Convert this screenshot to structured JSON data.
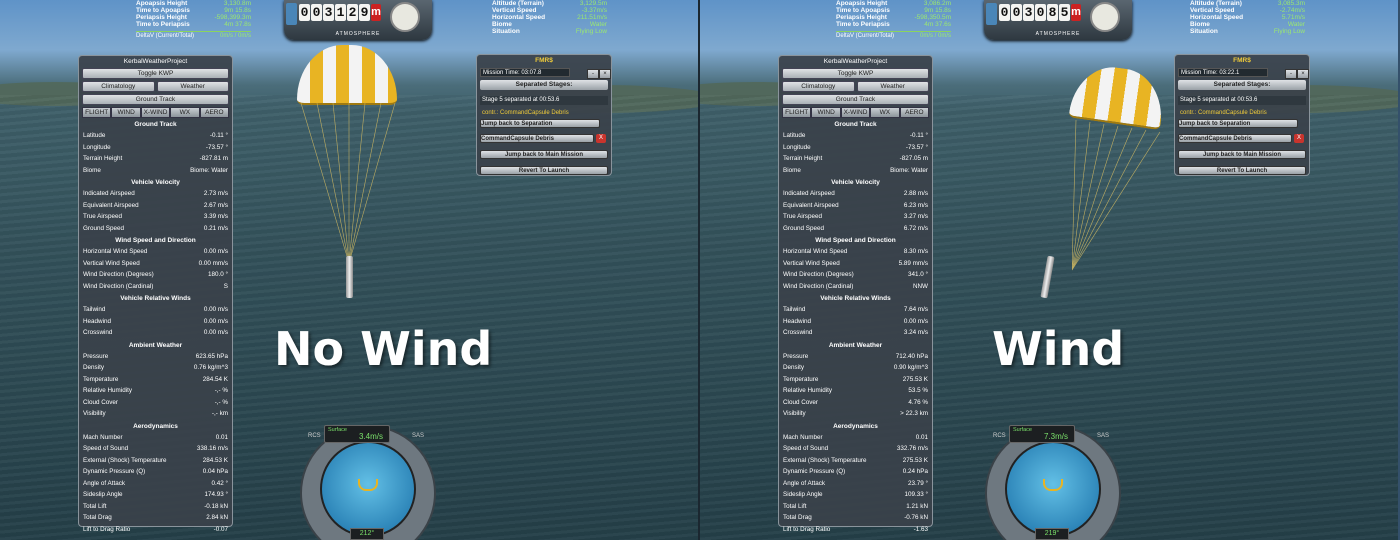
{
  "panels": [
    {
      "caption": "No Wind",
      "orbit": {
        "rows": [
          {
            "label": "Apoapsis Height",
            "value": "3,130.8m"
          },
          {
            "label": "Time to Apoapsis",
            "value": "9m 15.8s"
          },
          {
            "label": "Periapsis Height",
            "value": "-598,399.3m"
          },
          {
            "label": "Time to Periapsis",
            "value": "4m 37.8s"
          }
        ],
        "deltav_label": "DeltaV (Current/Total)",
        "deltav_value": "0m/s / 0m/s"
      },
      "surface": {
        "rows": [
          {
            "label": "Altitude (Terrain)",
            "value": "3,129.5m"
          },
          {
            "label": "Vertical Speed",
            "value": "-3.37m/s"
          },
          {
            "label": "Horizontal Speed",
            "value": "211.51m/s"
          },
          {
            "label": "Biome",
            "value": "Water"
          },
          {
            "label": "Situation",
            "value": "Flying Low"
          }
        ]
      },
      "altimeter": {
        "digits": [
          "0",
          "0",
          "3",
          "1",
          "2",
          "9"
        ],
        "unit": "m",
        "mode": "ATMOSPHERE"
      },
      "kwp": {
        "title": "KerbalWeatherProject",
        "toggle": "Toggle KWP",
        "climatology": "Climatology",
        "weather": "Weather",
        "ground_track": "Ground Track",
        "tabs": [
          "FLIGHT",
          "WIND",
          "X-WIND",
          "WX",
          "AERO"
        ],
        "sections": [
          {
            "title": "Ground Track",
            "rows": [
              {
                "label": "Latitude",
                "value": "-0.11 °"
              },
              {
                "label": "Longitude",
                "value": "-73.57 °"
              },
              {
                "label": "Terrain Height",
                "value": "-827.81 m"
              },
              {
                "label": "Biome",
                "value": "Biome: Water"
              }
            ]
          },
          {
            "title": "Vehicle Velocity",
            "rows": [
              {
                "label": "Indicated Airspeed",
                "value": "2.73 m/s"
              },
              {
                "label": "Equivalent Airspeed",
                "value": "2.67 m/s"
              },
              {
                "label": "True Airspeed",
                "value": "3.39 m/s"
              },
              {
                "label": "Ground Speed",
                "value": "0.21 m/s"
              }
            ]
          },
          {
            "title": "Wind Speed and Direction",
            "rows": [
              {
                "label": "Horizontal Wind Speed",
                "value": "0.00 m/s"
              },
              {
                "label": "Vertical Wind Speed",
                "value": "0.00 mm/s"
              },
              {
                "label": "Wind Direction (Degrees)",
                "value": "180.0 °"
              },
              {
                "label": "Wind Direction (Cardinal)",
                "value": "S"
              }
            ]
          },
          {
            "title": "Vehicle Relative Winds",
            "rows": [
              {
                "label": "Tailwind",
                "value": "0.00 m/s"
              },
              {
                "label": "Headwind",
                "value": "0.00 m/s"
              },
              {
                "label": "Crosswind",
                "value": "0.00 m/s"
              }
            ]
          },
          {
            "title": "Ambient Weather",
            "rows": [
              {
                "label": "Pressure",
                "value": "623.65 hPa"
              },
              {
                "label": "Density",
                "value": "0.76 kg/m^3"
              },
              {
                "label": "Temperature",
                "value": "284.54 K"
              },
              {
                "label": "Relative Humidity",
                "value": "-,- %"
              },
              {
                "label": "Cloud Cover",
                "value": "-,- %"
              },
              {
                "label": "Visibility",
                "value": "-,- km"
              }
            ]
          },
          {
            "title": "Aerodynamics",
            "rows": [
              {
                "label": "Mach Number",
                "value": "0.01"
              },
              {
                "label": "Speed of Sound",
                "value": "338.16 m/s"
              },
              {
                "label": "External (Shock) Temperature",
                "value": "284.53 K"
              },
              {
                "label": "Dynamic Pressure (Q)",
                "value": "0.04 hPa"
              },
              {
                "label": "Angle of Attack",
                "value": "0.42 °"
              },
              {
                "label": "Sideslip Angle",
                "value": "174.93 °"
              },
              {
                "label": "Total Lift",
                "value": "-0.18 kN"
              },
              {
                "label": "Total Drag",
                "value": "2.84 kN"
              },
              {
                "label": "Lift to Drag Ratio",
                "value": "-0.07"
              }
            ]
          }
        ]
      },
      "fmrs": {
        "title": "FMR$",
        "mission_time": "Mission Time: 03:07.8",
        "separated_stages": "Separated Stages:",
        "stage_info": "Stage 5 separated at 00:53.6",
        "contr": "contr.: CommandCapsule Debris",
        "jump_sep": "Jump back to Separation",
        "debris": "CommandCapsule Debris",
        "x": "X",
        "jump_main": "Jump back to Main Mission",
        "revert": "Revert To Launch",
        "minus": "-",
        "close": "×"
      },
      "navball": {
        "mode": "Surface",
        "speed": "3.4m/s",
        "heading": "212°",
        "rcs": "RCS",
        "sas": "SAS"
      }
    },
    {
      "caption": "Wind",
      "orbit": {
        "rows": [
          {
            "label": "Apoapsis Height",
            "value": "3,086.2m"
          },
          {
            "label": "Time to Apoapsis",
            "value": "9m 15.8s"
          },
          {
            "label": "Periapsis Height",
            "value": "-598,350.5m"
          },
          {
            "label": "Time to Periapsis",
            "value": "4m 37.6s"
          }
        ],
        "deltav_label": "DeltaV (Current/Total)",
        "deltav_value": "0m/s / 0m/s"
      },
      "surface": {
        "rows": [
          {
            "label": "Altitude (Terrain)",
            "value": "3,085.3m"
          },
          {
            "label": "Vertical Speed",
            "value": "-2.74m/s"
          },
          {
            "label": "Horizontal Speed",
            "value": "5.71m/s"
          },
          {
            "label": "Biome",
            "value": "Water"
          },
          {
            "label": "Situation",
            "value": "Flying Low"
          }
        ]
      },
      "altimeter": {
        "digits": [
          "0",
          "0",
          "3",
          "0",
          "8",
          "5"
        ],
        "unit": "m",
        "mode": "ATMOSPHERE"
      },
      "kwp": {
        "title": "KerbalWeatherProject",
        "toggle": "Toggle KWP",
        "climatology": "Climatology",
        "weather": "Weather",
        "ground_track": "Ground Track",
        "tabs": [
          "FLIGHT",
          "WIND",
          "X-WIND",
          "WX",
          "AERO"
        ],
        "sections": [
          {
            "title": "Ground Track",
            "rows": [
              {
                "label": "Latitude",
                "value": "-0.11 °"
              },
              {
                "label": "Longitude",
                "value": "-73.57 °"
              },
              {
                "label": "Terrain Height",
                "value": "-827.05 m"
              },
              {
                "label": "Biome",
                "value": "Biome: Water"
              }
            ]
          },
          {
            "title": "Vehicle Velocity",
            "rows": [
              {
                "label": "Indicated Airspeed",
                "value": "2.88 m/s"
              },
              {
                "label": "Equivalent Airspeed",
                "value": "6.23 m/s"
              },
              {
                "label": "True Airspeed",
                "value": "3.27 m/s"
              },
              {
                "label": "Ground Speed",
                "value": "6.72 m/s"
              }
            ]
          },
          {
            "title": "Wind Speed and Direction",
            "rows": [
              {
                "label": "Horizontal Wind Speed",
                "value": "8.30 m/s"
              },
              {
                "label": "Vertical Wind Speed",
                "value": "5.89 mm/s"
              },
              {
                "label": "Wind Direction (Degrees)",
                "value": "341.0 °"
              },
              {
                "label": "Wind Direction (Cardinal)",
                "value": "NNW"
              }
            ]
          },
          {
            "title": "Vehicle Relative Winds",
            "rows": [
              {
                "label": "Tailwind",
                "value": "7.64 m/s"
              },
              {
                "label": "Headwind",
                "value": "0.00 m/s"
              },
              {
                "label": "Crosswind",
                "value": "3.24 m/s"
              }
            ]
          },
          {
            "title": "Ambient Weather",
            "rows": [
              {
                "label": "Pressure",
                "value": "712.40 hPa"
              },
              {
                "label": "Density",
                "value": "0.90 kg/m^3"
              },
              {
                "label": "Temperature",
                "value": "275.53 K"
              },
              {
                "label": "Relative Humidity",
                "value": "53.5 %"
              },
              {
                "label": "Cloud Cover",
                "value": "4.76 %"
              },
              {
                "label": "Visibility",
                "value": "> 22.3 km"
              }
            ]
          },
          {
            "title": "Aerodynamics",
            "rows": [
              {
                "label": "Mach Number",
                "value": "0.01"
              },
              {
                "label": "Speed of Sound",
                "value": "332.76 m/s"
              },
              {
                "label": "External (Shock) Temperature",
                "value": "275.53 K"
              },
              {
                "label": "Dynamic Pressure (Q)",
                "value": "0.24 hPa"
              },
              {
                "label": "Angle of Attack",
                "value": "23.79 °"
              },
              {
                "label": "Sideslip Angle",
                "value": "109.33 °"
              },
              {
                "label": "Total Lift",
                "value": "1.21 kN"
              },
              {
                "label": "Total Drag",
                "value": "-0.76 kN"
              },
              {
                "label": "Lift to Drag Ratio",
                "value": "-1.63"
              }
            ]
          }
        ]
      },
      "fmrs": {
        "title": "FMR$",
        "mission_time": "Mission Time: 03:22.1",
        "separated_stages": "Separated Stages:",
        "stage_info": "Stage 5 separated at 00:53.6",
        "contr": "contr.: CommandCapsule Debris",
        "jump_sep": "Jump back to Separation",
        "debris": "CommandCapsule Debris",
        "x": "X",
        "jump_main": "Jump back to Main Mission",
        "revert": "Revert To Launch",
        "minus": "-",
        "close": "×"
      },
      "navball": {
        "mode": "Surface",
        "speed": "7.3m/s",
        "heading": "219°",
        "rcs": "RCS",
        "sas": "SAS"
      }
    }
  ],
  "colors": {
    "accent_green": "#9be870",
    "fmrs_title": "#f0cc3a",
    "close_red": "#c9342d",
    "chute_yellow": "#e8b423"
  },
  "icons": [
    "ship-badge-icon",
    "altimeter-dial-icon",
    "prograde-marker-icon"
  ]
}
